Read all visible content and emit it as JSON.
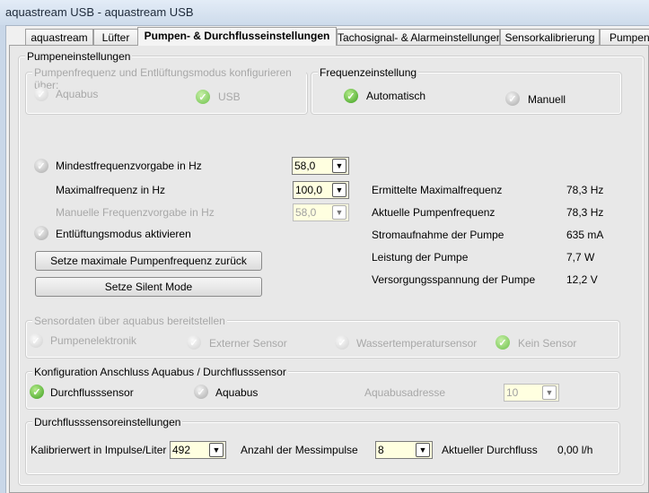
{
  "window": {
    "title": "aquastream USB - aquastream USB"
  },
  "tabs": [
    {
      "label": "aquastream"
    },
    {
      "label": "Lüfter"
    },
    {
      "label": "Pumpen- & Durchflusseinstellungen",
      "active": true
    },
    {
      "label": "Tachosignal- & Alarmeinstellungen"
    },
    {
      "label": "Sensorkalibrierung"
    },
    {
      "label": "Pumpenin"
    }
  ],
  "pump": {
    "title": "Pumpeneinstellungen",
    "config_via": {
      "title": "Pumpenfrequenz und Entlüftungsmodus konfigurieren über:",
      "aquabus": "Aquabus",
      "usb": "USB",
      "selected": "USB"
    },
    "freq_setting": {
      "title": "Frequenzeinstellung",
      "auto": "Automatisch",
      "manual": "Manuell",
      "selected": "Automatisch"
    },
    "min_freq": {
      "label": "Mindestfrequenzvorgabe in Hz",
      "value": "58,0"
    },
    "max_freq": {
      "label": "Maximalfrequenz in Hz",
      "value": "100,0"
    },
    "manual_freq": {
      "label": "Manuelle Frequenzvorgabe in Hz",
      "value": "58,0"
    },
    "vent_mode": {
      "label": "Entlüftungsmodus aktivieren"
    },
    "reset_button": "Setze maximale Pumpenfrequenz zurück",
    "silent_button": "Setze Silent Mode",
    "info": [
      {
        "label": "Ermittelte Maximalfrequenz",
        "value": "78,3 Hz"
      },
      {
        "label": "Aktuelle Pumpenfrequenz",
        "value": "78,3 Hz"
      },
      {
        "label": "Stromaufnahme der Pumpe",
        "value": "635 mA"
      },
      {
        "label": "Leistung der Pumpe",
        "value": "7,7 W"
      },
      {
        "label": "Versorgungsspannung der Pumpe",
        "value": "12,2 V"
      }
    ],
    "sensor_data": {
      "title": "Sensordaten über aquabus bereitstellen",
      "options": [
        "Pumpenelektronik",
        "Externer Sensor",
        "Wassertemperatursensor",
        "Kein Sensor"
      ],
      "selected": "Kein Sensor"
    },
    "connection": {
      "title": "Konfiguration Anschluss Aquabus / Durchflusssensor",
      "flow": "Durchflusssensor",
      "aquabus": "Aquabus",
      "selected": "Durchflusssensor",
      "address_label": "Aquabusadresse",
      "address_value": "10"
    },
    "flow": {
      "title": "Durchflusssensoreinstellungen",
      "calib_label": "Kalibrierwert in Impulse/Liter",
      "calib_value": "492",
      "pulses_label": "Anzahl der Messimpulse",
      "pulses_value": "8",
      "current_label": "Aktueller Durchfluss",
      "current_value": "0,00 l/h"
    }
  }
}
